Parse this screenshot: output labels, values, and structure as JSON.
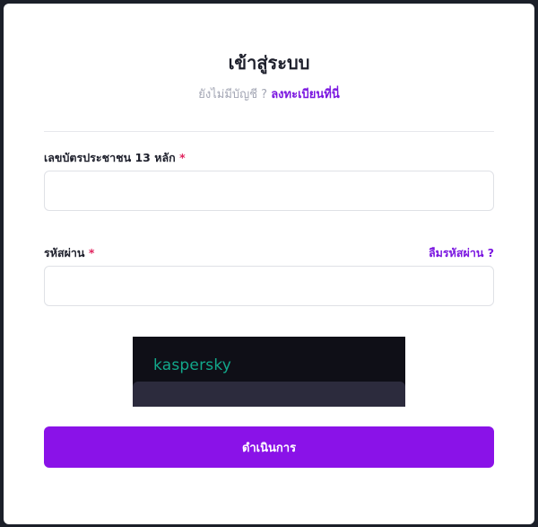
{
  "page": {
    "title": "เข้าสู่ระบบ",
    "subtitle_prefix": "ยังไม่มีบัญชี ? ",
    "register_link": "ลงทะเบียนที่นี่"
  },
  "form": {
    "id_label": "เลขบัตรประชาชน 13 หลัก",
    "id_value": "",
    "id_placeholder": "",
    "password_label": "รหัสผ่าน",
    "password_value": "",
    "password_placeholder": "",
    "required_mark": "*",
    "forgot_link": "ลืมรหัสผ่าน ?",
    "submit_label": "ดำเนินการ"
  },
  "widget": {
    "brand": "kaspersky"
  },
  "colors": {
    "accent": "#8a12e8",
    "link": "#7a16e0",
    "required": "#e0245e",
    "brand": "#12a88b"
  }
}
